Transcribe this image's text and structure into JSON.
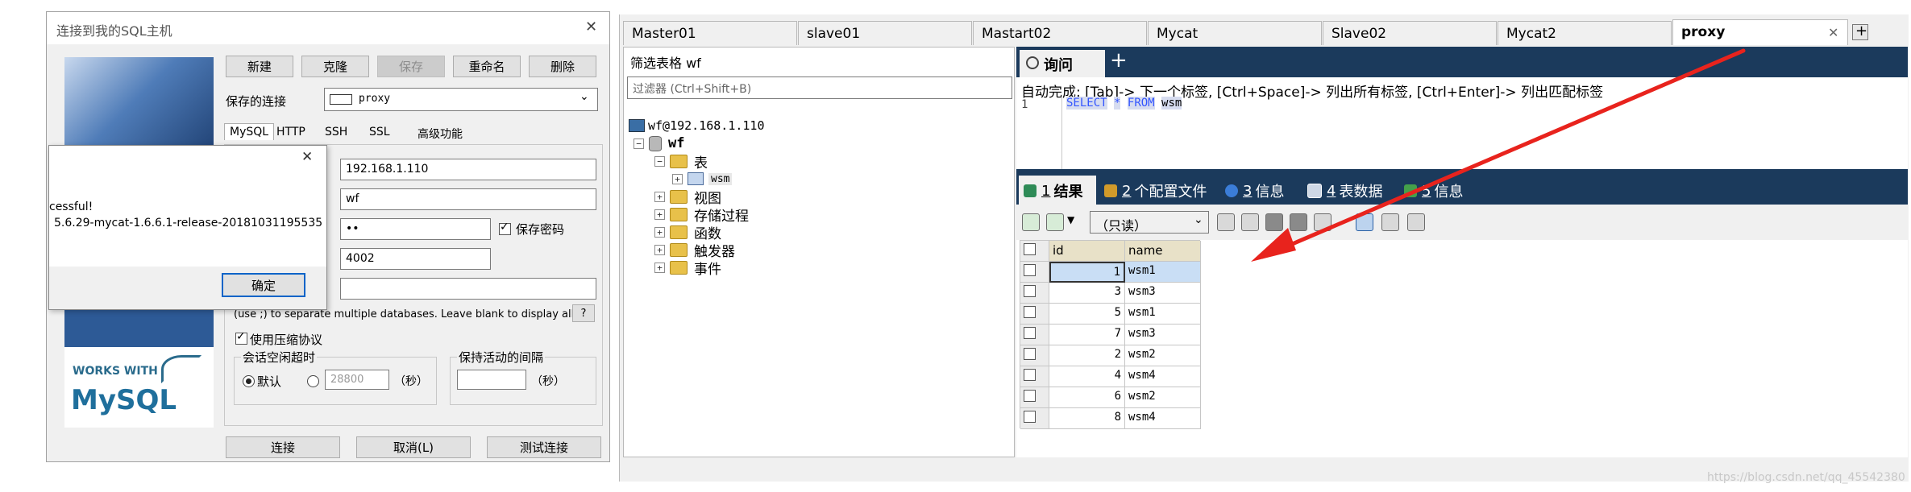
{
  "dialog": {
    "title": "连接到我的SQL主机",
    "close_glyph": "✕",
    "buttons": {
      "new": "新建",
      "clone": "克隆",
      "save": "保存",
      "rename": "重命名",
      "delete": "删除"
    },
    "saved_conn_label": "保存的连接",
    "saved_conn_value": "proxy",
    "tabs": [
      "MySQL",
      "HTTP",
      "SSH",
      "SSL",
      "高级功能"
    ],
    "host_value": "192.168.1.110",
    "user_value": "wf",
    "password_value": "••",
    "save_password_label": "保存密码",
    "port_value": "4002",
    "database_value": "",
    "database_hint": "(use ;) to separate multiple databases. Leave blank to display all)",
    "help_label": "?",
    "compress_label": "使用压缩协议",
    "session_group_label": "会话空闲超时",
    "default_label": "默认",
    "timeout_value": "28800",
    "seconds_label": "（秒）",
    "keepalive_group_label": "保持活动的间隔",
    "keepalive_value": "",
    "connect_button": "连接",
    "cancel_button": "取消(L)",
    "test_button": "测试连接",
    "logo_works_with": "WORKS WITH",
    "logo_mysql": "MySQL"
  },
  "popup": {
    "close_glyph": "✕",
    "message_line1": "cessful!",
    "message_line2": "5.6.29-mycat-1.6.6.1-release-20181031195535",
    "ok_button": "确定"
  },
  "tabs": [
    {
      "label": "Master01",
      "active": false
    },
    {
      "label": "slave01",
      "active": false
    },
    {
      "label": "Mastart02",
      "active": false
    },
    {
      "label": "Mycat",
      "active": false
    },
    {
      "label": "Slave02",
      "active": false
    },
    {
      "label": "Mycat2",
      "active": false
    },
    {
      "label": "proxy",
      "active": true
    }
  ],
  "active_tab_close": "✕",
  "add_tab_glyph": "+",
  "left_panel": {
    "filter_label": "筛选表格 wf",
    "filter_placeholder": "过滤器 (Ctrl+Shift+B)",
    "connection_node": "wf@192.168.1.110",
    "db_node": "wf",
    "tables_node": "表",
    "table_wsm": "wsm",
    "views": "视图",
    "procs": "存储过程",
    "funcs": "函数",
    "triggers": "触发器",
    "events": "事件",
    "expander_minus": "−",
    "expander_plus": "+"
  },
  "query": {
    "tab_label": "询问",
    "add_glyph": "+",
    "autocomplete_hint": "自动完成: [Tab]-> 下一个标签, [Ctrl+Space]-> 列出所有标签, [Ctrl+Enter]-> 列出匹配标签",
    "line_no": "1",
    "sql": {
      "select": "SELECT",
      "star": "*",
      "from": "FROM",
      "table": "wsm"
    }
  },
  "result_tabs": [
    {
      "num": "1",
      "label": "结果"
    },
    {
      "num": "2",
      "label": "个配置文件"
    },
    {
      "num": "3",
      "label": "信息"
    },
    {
      "num": "4",
      "label": "表数据"
    },
    {
      "num": "5",
      "label": "信息"
    }
  ],
  "readonly_select": "（只读）",
  "grid": {
    "headers": [
      "id",
      "name"
    ],
    "rows": [
      [
        "1",
        "wsm1"
      ],
      [
        "3",
        "wsm3"
      ],
      [
        "5",
        "wsm1"
      ],
      [
        "7",
        "wsm3"
      ],
      [
        "2",
        "wsm2"
      ],
      [
        "4",
        "wsm4"
      ],
      [
        "6",
        "wsm2"
      ],
      [
        "8",
        "wsm4"
      ]
    ]
  },
  "watermark": "https://blog.csdn.net/qq_45542380",
  "colors": {
    "dark_blue": "#1b3a5c",
    "arrow_red": "#e8231d",
    "selected_cell": "#c9def5"
  }
}
